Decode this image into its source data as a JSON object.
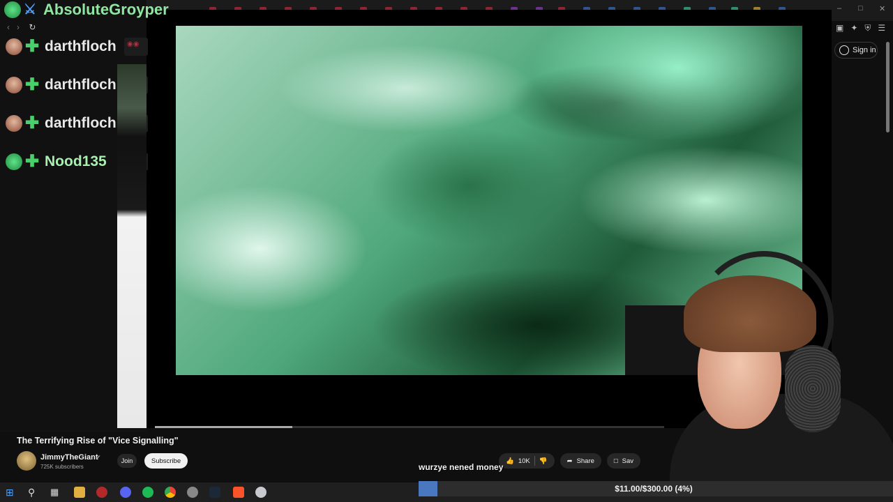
{
  "browser": {
    "sign_in_label": "Sign in"
  },
  "chat": {
    "header_user": "AbsoluteGroyper",
    "messages": [
      {
        "user": "darthfloch"
      },
      {
        "user": "darthfloch"
      },
      {
        "user": "darthfloch"
      },
      {
        "user": "Nood135"
      }
    ]
  },
  "video": {
    "title": "The Terrifying Rise of \"Vice Signalling\"",
    "channel": "JimmyTheGiant",
    "subscribers": "725K subscribers",
    "join_label": "Join",
    "subscribe_label": "Subscribe",
    "likes": "10K",
    "share_label": "Share",
    "save_label": "Sav",
    "progress_fraction": 0.27
  },
  "overlay": {
    "caption": "wurzye nened money",
    "goal_text": "$11.00/$300.00 (4%)",
    "goal_fraction": 0.04
  },
  "colors": {
    "accent": "#4a78c0",
    "badge_green": "#4ad06a"
  }
}
